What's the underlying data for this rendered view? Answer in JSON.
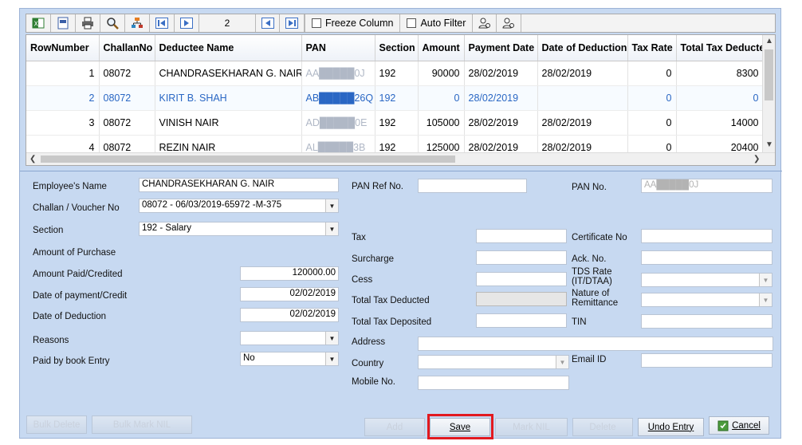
{
  "toolbar": {
    "page_number": "2",
    "freeze_column_label": "Freeze Column",
    "auto_filter_label": "Auto Filter"
  },
  "grid": {
    "columns": [
      "RowNumber",
      "ChallanNo",
      "Deductee Name",
      "PAN",
      "Section",
      "Amount",
      "Payment Date",
      "Date of Deduction",
      "Tax Rate",
      "Total Tax Deducted"
    ],
    "rows": [
      {
        "row": "1",
        "challan": "08072",
        "name": "CHANDRASEKHARAN G. NAIR",
        "pan": "AA█████0J",
        "section": "192",
        "amount": "90000",
        "pay_date": "28/02/2019",
        "ded_date": "28/02/2019",
        "rate": "0",
        "total": "8300"
      },
      {
        "row": "2",
        "challan": "08072",
        "name": "KIRIT B. SHAH",
        "pan": "AB█████26Q",
        "section": "192",
        "amount": "0",
        "pay_date": "28/02/2019",
        "ded_date": "",
        "rate": "0",
        "total": "0"
      },
      {
        "row": "3",
        "challan": "08072",
        "name": "VINISH NAIR",
        "pan": "AD█████0E",
        "section": "192",
        "amount": "105000",
        "pay_date": "28/02/2019",
        "ded_date": "28/02/2019",
        "rate": "0",
        "total": "14000"
      },
      {
        "row": "4",
        "challan": "08072",
        "name": "REZIN NAIR",
        "pan": "AL█████3B",
        "section": "192",
        "amount": "125000",
        "pay_date": "28/02/2019",
        "ded_date": "28/02/2019",
        "rate": "0",
        "total": "20400"
      }
    ]
  },
  "form": {
    "employee_name_label": "Employee's Name",
    "employee_name_value": "CHANDRASEKHARAN G. NAIR",
    "challan_label": "Challan / Voucher No",
    "challan_value": "08072    - 06/03/2019-65972 -M-375",
    "section_label": "Section",
    "section_value": "192       - Salary",
    "amount_purchase_label": "Amount of Purchase",
    "amount_paid_label": "Amount Paid/Credited",
    "amount_paid_value": "120000.00",
    "date_payment_label": "Date of payment/Credit",
    "date_payment_value": "02/02/2019",
    "date_deduction_label": "Date of Deduction",
    "date_deduction_value": "02/02/2019",
    "reasons_label": "Reasons",
    "reasons_value": "",
    "book_entry_label": "Paid by book Entry",
    "book_entry_value": "No",
    "pan_ref_label": "PAN Ref No.",
    "pan_no_label": "PAN No.",
    "pan_no_value": "AA█████0J",
    "tax_label": "Tax",
    "surcharge_label": "Surcharge",
    "cess_label": "Cess",
    "total_deducted_label": "Total Tax Deducted",
    "total_deposited_label": "Total Tax Deposited",
    "certificate_label": "Certificate No",
    "ack_label": "Ack. No.",
    "tds_rate_label_1": "TDS Rate",
    "tds_rate_label_2": "(IT/DTAA)",
    "nature_label_1": "Nature of",
    "nature_label_2": "Remittance",
    "tin_label": "TIN",
    "address_label": "Address",
    "country_label": "Country",
    "email_label": "Email ID",
    "mobile_label": "Mobile No."
  },
  "buttons": {
    "bulk_delete": "Bulk Delete",
    "bulk_mark_nil": "Bulk Mark NIL",
    "add": "Add",
    "save": "Save",
    "mark_nil": "Mark NIL",
    "delete": "Delete",
    "undo_entry": "Undo Entry",
    "cancel": "Cancel"
  },
  "colors": {
    "panel": "#c7d9f1",
    "selected_row_text": "#2a67c4",
    "highlight": "#e2191f"
  }
}
